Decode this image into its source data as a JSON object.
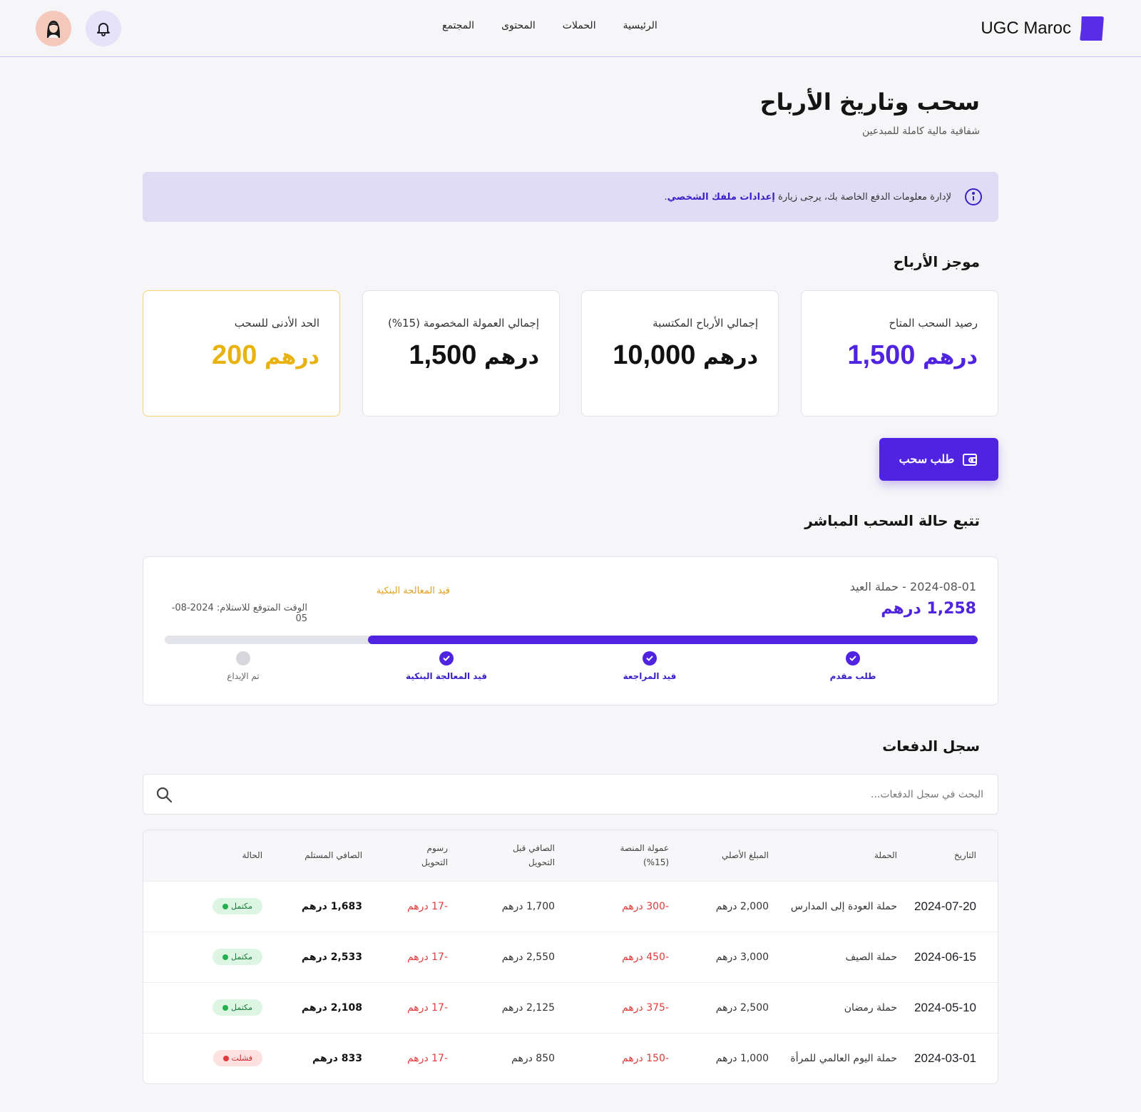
{
  "header": {
    "brand": "UGC Maroc",
    "nav": [
      "الرئيسية",
      "الحملات",
      "المحتوى",
      "المجتمع"
    ]
  },
  "page": {
    "title": "سحب وتاريخ الأرباح",
    "subtitle": "شفافية مالية كاملة للمبدعين"
  },
  "banner": {
    "text": "لإدارة معلومات الدفع الخاصة بك، يرجى زيارة",
    "link": "إعدادات ملفك الشخصي",
    "end": "."
  },
  "summary": {
    "title": "موجز الأرباح",
    "cards": [
      {
        "label": "رصيد السحب المتاح",
        "amount": "1,500",
        "currency": "درهم",
        "color": "#4f23e0"
      },
      {
        "label": "إجمالي الأرباح المكتسبة",
        "amount": "10,000",
        "currency": "درهم",
        "color": "#111111"
      },
      {
        "label": "إجمالي العمولة المخصومة (15%)",
        "amount": "1,500",
        "currency": "درهم",
        "color": "#111111"
      },
      {
        "label": "الحد الأدنى للسحب",
        "amount": "200",
        "currency": "درهم",
        "color": "#e8b30e"
      }
    ]
  },
  "withdraw_button": "طلب سحب",
  "tracking": {
    "title": "تتبع حالة السحب المباشر",
    "date_campaign": "2024-08-01 - حملة العيد",
    "amount": "1,258 درهم",
    "status": "قيد المعالجة البنكية",
    "eta": "الوقت المتوقع للاستلام: 2024-08-05",
    "progress": 0.75,
    "steps": [
      {
        "label": "طلب مقدم",
        "done": true
      },
      {
        "label": "قيد المراجعة",
        "done": true
      },
      {
        "label": "قيد المعالجة البنكية",
        "done": true
      },
      {
        "label": "تم الإيداع",
        "done": false
      }
    ]
  },
  "history": {
    "title": "سجل الدفعات",
    "search_placeholder": "البحث في سجل الدفعات...",
    "columns": [
      "التاريخ",
      "الحملة",
      "المبلغ الأصلي",
      "عمولة المنصة (15%)",
      "الصافي قبل التحويل",
      "رسوم التحويل",
      "الصافي المستلم",
      "الحالة"
    ],
    "rows": [
      {
        "date": "2024-07-20",
        "campaign": "حملة العودة إلى المدارس",
        "original": "2,000 درهم",
        "commission": "-300 درهم",
        "pre_net": "1,700 درهم",
        "fee": "-17 درهم",
        "net": "1,683 درهم",
        "status": "مكتمل",
        "ok": true
      },
      {
        "date": "2024-06-15",
        "campaign": "حملة الصيف",
        "original": "3,000 درهم",
        "commission": "-450 درهم",
        "pre_net": "2,550 درهم",
        "fee": "-17 درهم",
        "net": "2,533 درهم",
        "status": "مكتمل",
        "ok": true
      },
      {
        "date": "2024-05-10",
        "campaign": "حملة رمضان",
        "original": "2,500 درهم",
        "commission": "-375 درهم",
        "pre_net": "2,125 درهم",
        "fee": "-17 درهم",
        "net": "2,108 درهم",
        "status": "مكتمل",
        "ok": true
      },
      {
        "date": "2024-03-01",
        "campaign": "حملة اليوم العالمي للمرأة",
        "original": "1,000 درهم",
        "commission": "-150 درهم",
        "pre_net": "850 درهم",
        "fee": "-17 درهم",
        "net": "833 درهم",
        "status": "فشلت",
        "ok": false
      }
    ]
  },
  "icons": [
    "bell-icon",
    "avatar",
    "info-icon",
    "wallet-icon",
    "check-icon",
    "search-icon"
  ]
}
